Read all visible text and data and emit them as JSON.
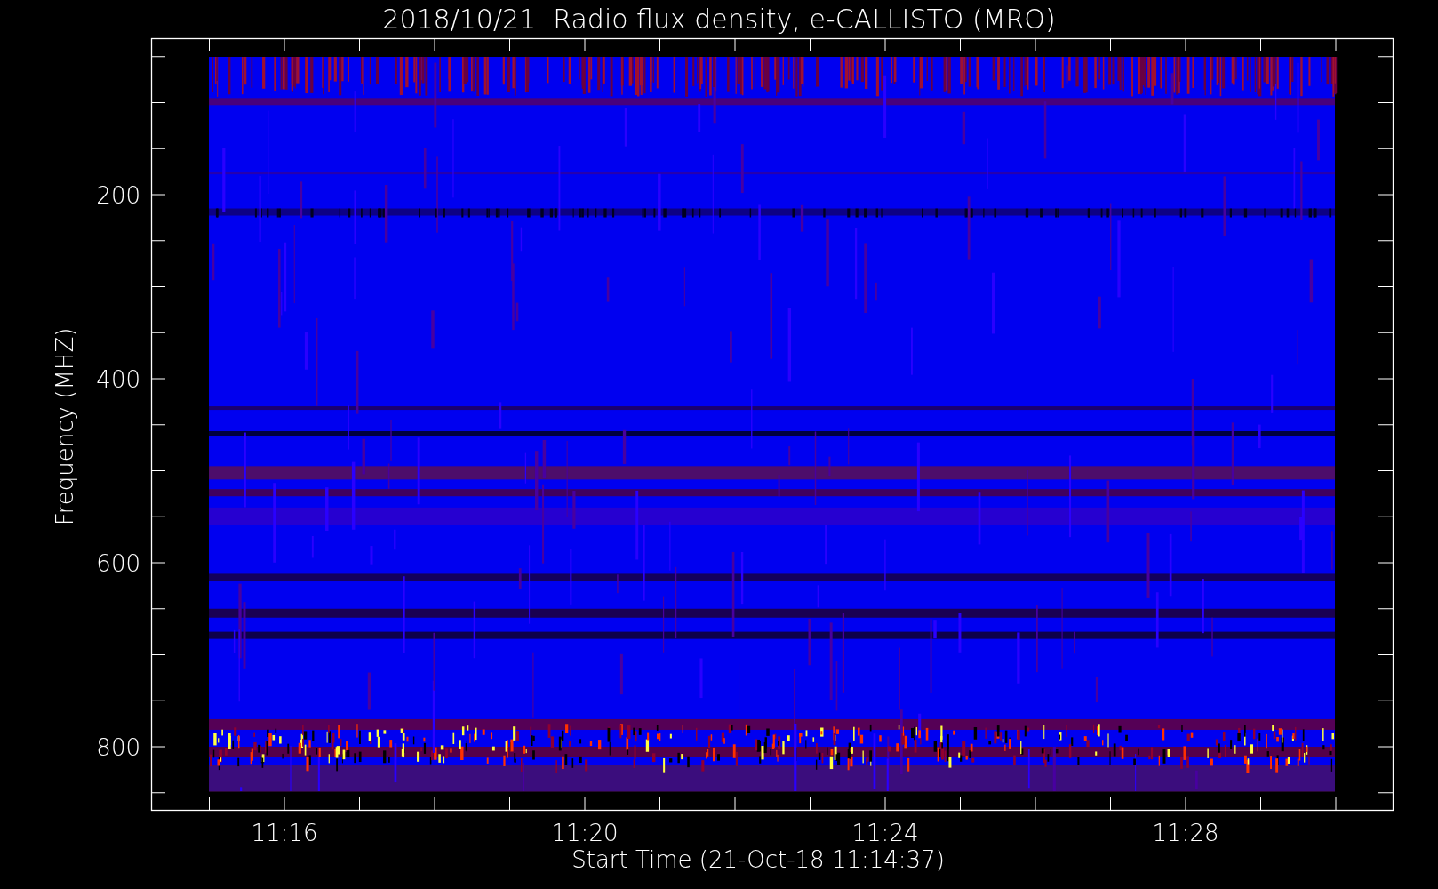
{
  "title": "2018/10/21  Radio flux density, e-CALLISTO (MRO)",
  "y_axis": {
    "label": "Frequency (MHZ)",
    "tick_labels": [
      "200",
      "400",
      "600",
      "800"
    ]
  },
  "x_axis": {
    "label": "Start Time (21-Oct-18 11:14:37)",
    "tick_labels": [
      "11:16",
      "11:20",
      "11:24",
      "11:28"
    ]
  }
}
